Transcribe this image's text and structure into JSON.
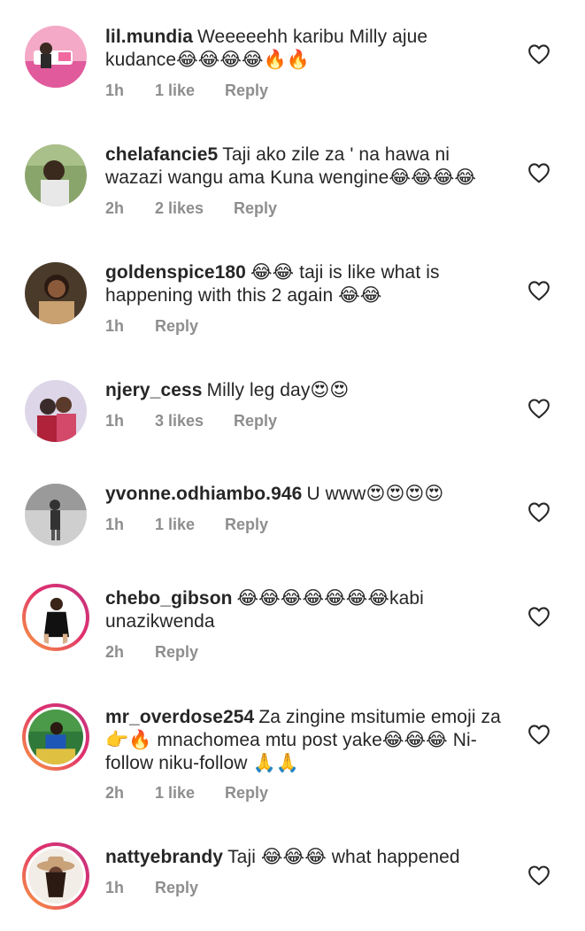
{
  "comments": [
    {
      "username": "lil.mundia",
      "text": "Weeeeehh karibu Milly ajue kudance😂😂😂😂🔥🔥",
      "time": "1h",
      "likes": "1 like",
      "reply": "Reply",
      "avatar_colors": [
        "#f4a9c6",
        "#ffffff",
        "#e05a9c"
      ],
      "story_ring": false
    },
    {
      "username": "chelafancie5",
      "text": "Taji ako zile za ' na hawa ni wazazi wangu ama Kuna wengine😂😂😂😂",
      "time": "2h",
      "likes": "2 likes",
      "reply": "Reply",
      "avatar_colors": [
        "#8aa56b",
        "#3a2a1e",
        "#e8e8e8"
      ],
      "story_ring": false
    },
    {
      "username": "goldenspice180",
      "text": "😂😂 taji is like what is happening  with this 2 again 😂😂",
      "time": "1h",
      "likes": "",
      "reply": "Reply",
      "avatar_colors": [
        "#4a3a2a",
        "#2b1a12",
        "#c9a070"
      ],
      "story_ring": false
    },
    {
      "username": "njery_cess",
      "text": "Milly leg day😍😍",
      "time": "1h",
      "likes": "3 likes",
      "reply": "Reply",
      "avatar_colors": [
        "#ddd6e8",
        "#b0223a",
        "#3a2a2a"
      ],
      "story_ring": false
    },
    {
      "username": "yvonne.odhiambo.946",
      "text": "U www😍😍😍😍",
      "time": "1h",
      "likes": "1 like",
      "reply": "Reply",
      "avatar_colors": [
        "#9a9a9a",
        "#333333",
        "#cfcfcf"
      ],
      "story_ring": false
    },
    {
      "username": "chebo_gibson",
      "text": "😂😂😂😂😂😂😂kabi unazikwenda",
      "time": "2h",
      "likes": "",
      "reply": "Reply",
      "avatar_colors": [
        "#ffffff",
        "#111111",
        "#d8b08a"
      ],
      "story_ring": true
    },
    {
      "username": "mr_overdose254",
      "text": "Za zingine msitumie emoji za 👉🔥 mnachomea mtu post yake😂😂😂 Ni-follow niku-follow 🙏🙏",
      "time": "2h",
      "likes": "1 like",
      "reply": "Reply",
      "avatar_colors": [
        "#2f7a3a",
        "#1e56b8",
        "#e0c040"
      ],
      "story_ring": true
    },
    {
      "username": "nattyebrandy",
      "text": "Taji 😂😂😂 what happened",
      "time": "1h",
      "likes": "",
      "reply": "Reply",
      "avatar_colors": [
        "#f2ede6",
        "#c9a27a",
        "#2a1a12"
      ],
      "story_ring": true
    }
  ],
  "icons": {
    "like": "heart-outline-icon"
  },
  "colors": {
    "text": "#262626",
    "meta": "#8e8e8e",
    "heart": "#262626"
  }
}
